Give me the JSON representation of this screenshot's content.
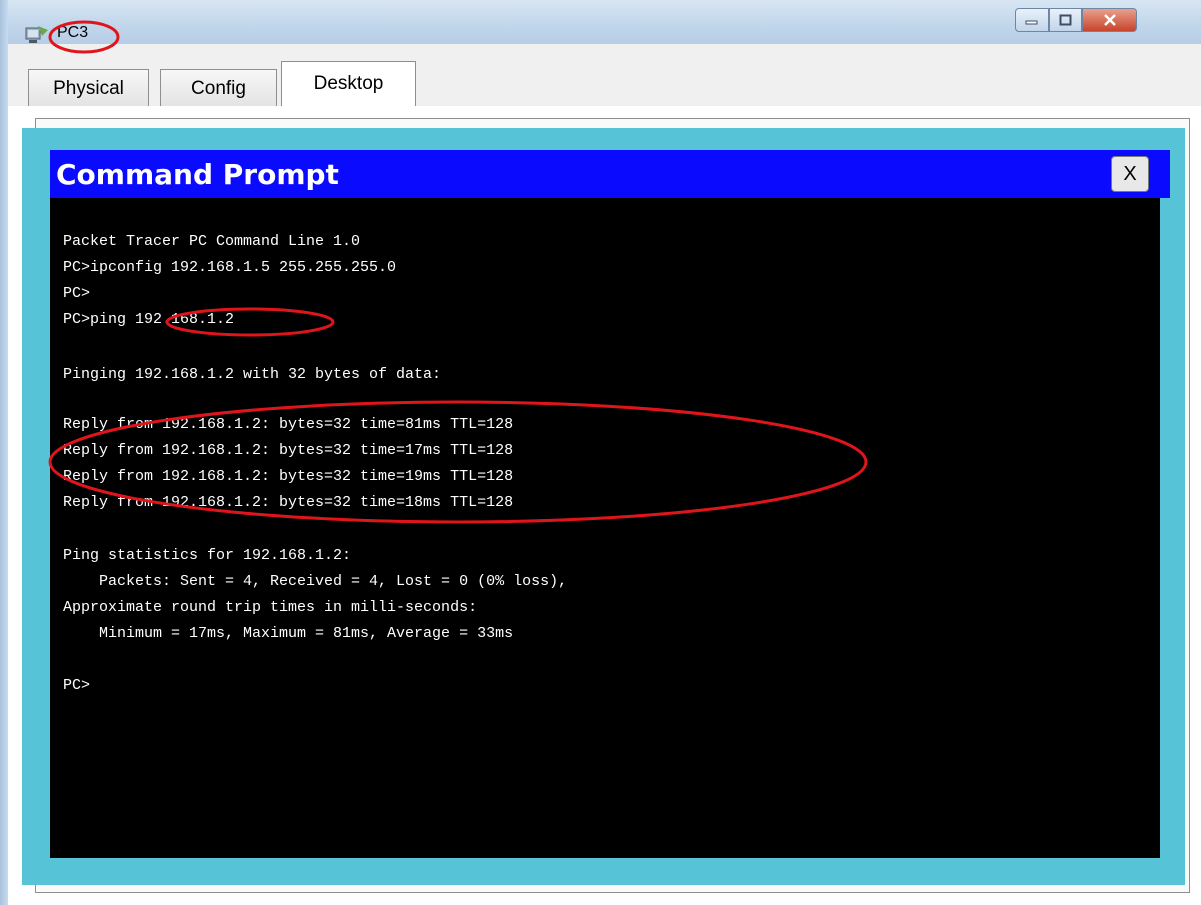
{
  "window": {
    "title": "PC3"
  },
  "tabs": [
    {
      "label": "Physical"
    },
    {
      "label": "Config"
    },
    {
      "label": "Desktop"
    }
  ],
  "command_prompt": {
    "title": "Command Prompt",
    "close_label": "X",
    "lines": [
      "Packet Tracer PC Command Line 1.0",
      "PC>ipconfig 192.168.1.5 255.255.255.0",
      "PC>",
      "PC>ping 192.168.1.2",
      "",
      "Pinging 192.168.1.2 with 32 bytes of data:",
      "",
      "Reply from 192.168.1.2: bytes=32 time=81ms TTL=128",
      "Reply from 192.168.1.2: bytes=32 time=17ms TTL=128",
      "Reply from 192.168.1.2: bytes=32 time=19ms TTL=128",
      "Reply from 192.168.1.2: bytes=32 time=18ms TTL=128",
      "",
      "Ping statistics for 192.168.1.2:",
      "    Packets: Sent = 4, Received = 4, Lost = 0 (0% loss),",
      "Approximate round trip times in milli-seconds:",
      "    Minimum = 17ms, Maximum = 81ms, Average = 33ms",
      "",
      "PC>"
    ]
  },
  "colors": {
    "header_blue": "#0a0aff",
    "frame_cyan": "#56c4d6",
    "terminal_bg": "#000000",
    "annotation_red": "#e0151c"
  },
  "icons": [
    "app-icon",
    "minimize-icon",
    "maximize-icon",
    "close-icon"
  ]
}
